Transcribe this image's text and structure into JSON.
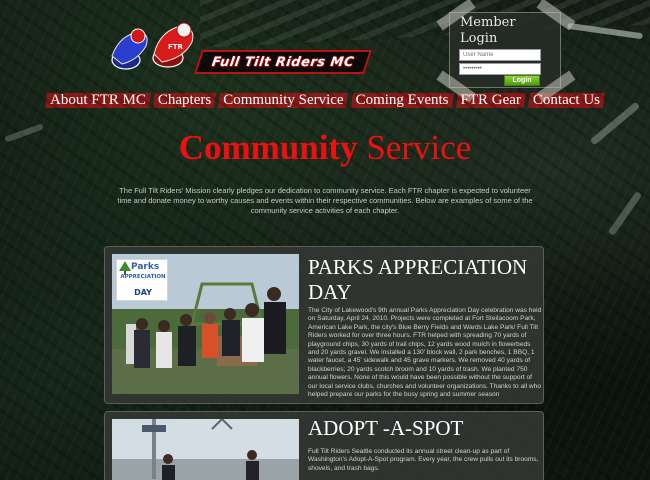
{
  "logo": {
    "name": "Full Tilt Riders MC"
  },
  "login": {
    "title": "Member Login",
    "username_placeholder": "User Name",
    "password_value": "•••••••••",
    "button_label": "Login"
  },
  "nav": {
    "items": [
      {
        "label": "About FTR MC"
      },
      {
        "label": "Chapters"
      },
      {
        "label": "Community Service"
      },
      {
        "label": "Coming Events"
      },
      {
        "label": "FTR Gear"
      },
      {
        "label": "Contact Us"
      }
    ]
  },
  "page": {
    "title_bold": "Community",
    "title_rest": "Service",
    "intro": "The Full Tilt Riders' Mission clearly pledges our dedication to community service. Each FTR chapter is expected to volunteer time and donate money to worthy causes and events within their respective communities. Below are examples of some of the community service activities of each chapter."
  },
  "cards": [
    {
      "title": "PARKS APPRECIATION DAY",
      "badge_word": "Parks",
      "badge_sub": "APPRECIATION",
      "badge_day": "DAY",
      "body": "The City of Lakewood's 9th annual Parks Appreciation Day celebration was held on Saturday, April 24, 2010. Projects were completed at Fort Steilacoom Park, American Lake Park, the city's Blue Berry Fields and Wards Lake Park/ Full Tilt Riders worked for over three hours. FTR helped with spreading 70 yards of playground chips, 30 yards of trail chips, 12 yards wood mulch in flowerbeds and 20 yards gravel. We installed a 130' block wall, 2 park benches, 1 BBQ, 1 water faucet, a 45' sidewalk and 45 grave markers. We removed 40 yards of blackberries; 20 yards scotch broom and 10 yards of trash. We planted 750 annual flowers. None of this would have been possible without the support of our local service clubs, churches and volunteer organizations. Thanks to all who helped prepare our parks for the busy spring and summer season"
    },
    {
      "title": "ADOPT -A-SPOT",
      "body": "Full Tilt Riders Seattle conducted its annual street clean-up as part of Washington's Adopt-A-Spot program. Every year, the crew pulls out its brooms, shovels, and trash bags."
    }
  ],
  "colors": {
    "accent_red": "#ee1010",
    "nav_red": "#a51414",
    "login_green": "#5aa81a",
    "card_bg": "#343834"
  }
}
